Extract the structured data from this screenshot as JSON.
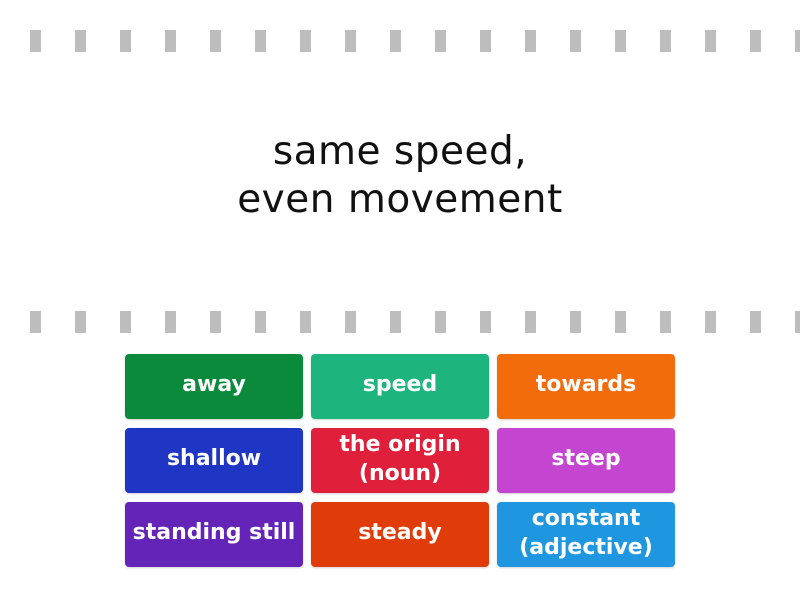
{
  "prompt": {
    "lines": [
      "same speed,",
      "even movement"
    ]
  },
  "dash_count": 18,
  "colors": {
    "dash": "#bdbdbd",
    "prompt_text": "#111111",
    "tile_text": "#ffffff"
  },
  "tiles": [
    {
      "lines": [
        "away"
      ],
      "color": "#0b8a3c"
    },
    {
      "lines": [
        "speed"
      ],
      "color": "#1db57d"
    },
    {
      "lines": [
        "towards"
      ],
      "color": "#f26c0c"
    },
    {
      "lines": [
        "shallow"
      ],
      "color": "#1f35c4"
    },
    {
      "lines": [
        "the origin",
        "(noun)"
      ],
      "color": "#e0203a"
    },
    {
      "lines": [
        "steep"
      ],
      "color": "#c445cf"
    },
    {
      "lines": [
        "standing still"
      ],
      "color": "#6424b8"
    },
    {
      "lines": [
        "steady"
      ],
      "color": "#e03c0a"
    },
    {
      "lines": [
        "constant",
        "(adjective)"
      ],
      "color": "#1e97e0"
    }
  ]
}
